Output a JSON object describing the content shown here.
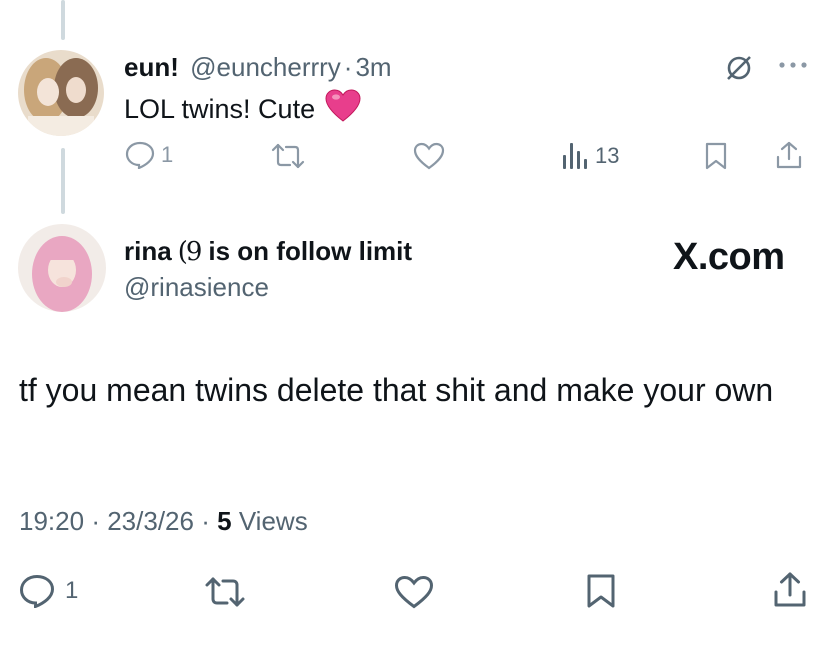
{
  "reply_tweet": {
    "display_name": "eun!",
    "handle": "@euncherrry",
    "separator": "·",
    "time_ago": "3m",
    "text": "LOL twins! Cute",
    "emoji": "💗",
    "reply_count": "1",
    "views": "13",
    "more_icon": "ellipsis-icon",
    "grok_icon": "grok-icon"
  },
  "main_tweet": {
    "display_name": "rina",
    "name_suffix": "is on follow limit",
    "handle": "@rinasience",
    "text": "tf you mean twins delete that shit and make your own",
    "time": "19:20",
    "date": "23/3/26",
    "separator": "·",
    "views_count": "5",
    "views_label": "Views",
    "reply_count": "1"
  },
  "watermark": {
    "text": "X.com"
  },
  "colors": {
    "text": "#0f1419",
    "muted": "#536471",
    "icon_gray": "#8b98a5",
    "thread_line": "#cfd9de",
    "heart_emoji": "#e83e8c"
  }
}
